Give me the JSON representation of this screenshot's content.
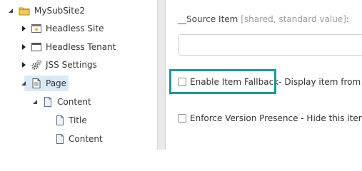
{
  "tree": {
    "root": {
      "label": "MySubSite2",
      "icon": "folder-icon"
    },
    "items": [
      {
        "label": "Headless Site",
        "icon": "site-star-icon"
      },
      {
        "label": "Headless Tenant",
        "icon": "window-icon"
      },
      {
        "label": "JSS Settings",
        "icon": "gears-icon"
      },
      {
        "label": "Page",
        "icon": "page-icon",
        "selected": true
      },
      {
        "label": "Content",
        "icon": "document-icon"
      },
      {
        "label": "Title",
        "icon": "document-icon"
      },
      {
        "label": "Content",
        "icon": "document-icon"
      }
    ]
  },
  "editor": {
    "source_item": {
      "label": "__Source Item",
      "hint": "[shared, standard value]",
      "colon": ":",
      "value": ""
    },
    "item_fallback": {
      "label": "Enable Item Fallback",
      "description": " - Display item from fal",
      "checked": false
    },
    "version_presence": {
      "label": "Enforce Version Presence - Hide this item if",
      "checked": false
    }
  },
  "colors": {
    "selection": "#d9eaf7",
    "highlight_border": "#1a9a9a",
    "folder": "#f2c94c"
  }
}
